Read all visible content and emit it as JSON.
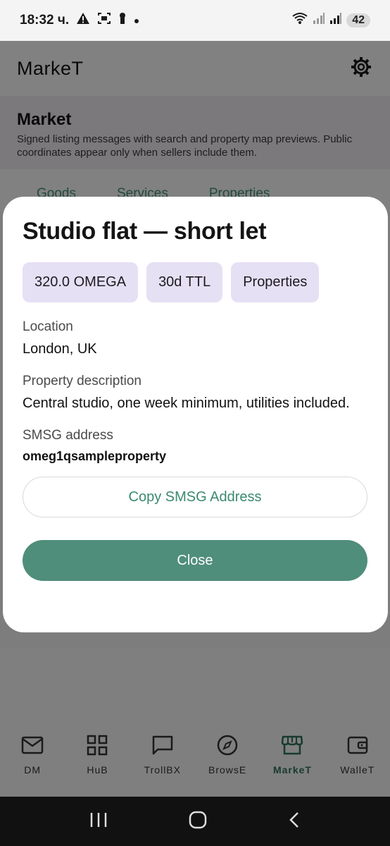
{
  "status_bar": {
    "time": "18:32 ч.",
    "battery": "42"
  },
  "app_bar": {
    "title": "MarkeT"
  },
  "market": {
    "title": "Market",
    "subtitle": "Signed listing messages with search and property map previews. Public coordinates appear only when sellers include them."
  },
  "tabs": [
    "Goods",
    "Services",
    "Properties"
  ],
  "dialog": {
    "title": "Studio flat — short let",
    "chips": [
      "320.0 OMEGA",
      "30d TTL",
      "Properties"
    ],
    "location_label": "Location",
    "location_value": "London, UK",
    "description_label": "Property description",
    "description_value": "Central studio, one week minimum, utilities included.",
    "address_label": "SMSG address",
    "address_value": "omeg1qsampleproperty",
    "copy_label": "Copy SMSG Address",
    "close_label": "Close"
  },
  "bottom_nav": {
    "items": [
      {
        "label": "DM",
        "icon": "mail-icon"
      },
      {
        "label": "HuB",
        "icon": "grid-icon"
      },
      {
        "label": "TrollBX",
        "icon": "chat-icon"
      },
      {
        "label": "BrowsE",
        "icon": "compass-icon"
      },
      {
        "label": "MarkeT",
        "icon": "store-icon",
        "active": true
      },
      {
        "label": "WalleT",
        "icon": "wallet-icon"
      }
    ]
  },
  "colors": {
    "accent": "#4f8e7a",
    "chip": "#e6e0f4"
  }
}
